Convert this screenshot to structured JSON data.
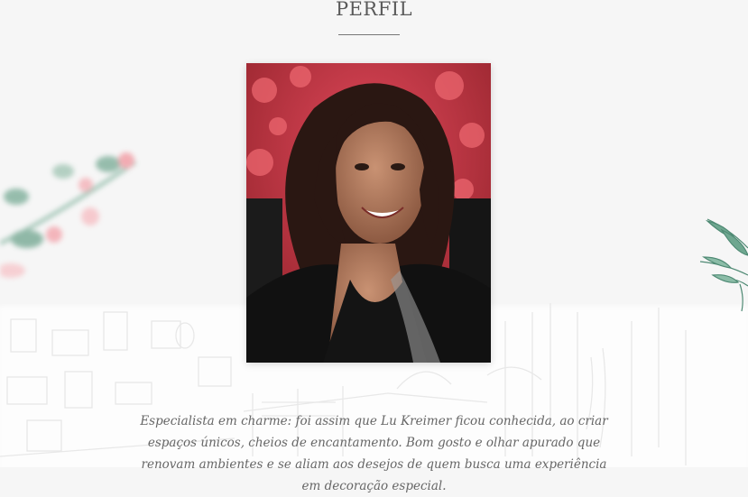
{
  "section": {
    "title": "PERFIL"
  },
  "profile": {
    "photo_alt": "Lu Kreimer",
    "bio": "Especialista em charme: foi assim que Lu Kreimer ficou conhecida, ao criar espaços únicos, cheios de encantamento. Bom gosto e olhar apurado que renovam ambientes e se aliam aos desejos de quem busca uma experiência em decoração especial."
  },
  "colors": {
    "background_top": "#f6f6f6",
    "background_bottom": "#fdfdfd",
    "title": "#5a5a5a",
    "text": "#666666",
    "flower_accent": "#e0485a",
    "leaf_accent": "#4f8a74"
  }
}
